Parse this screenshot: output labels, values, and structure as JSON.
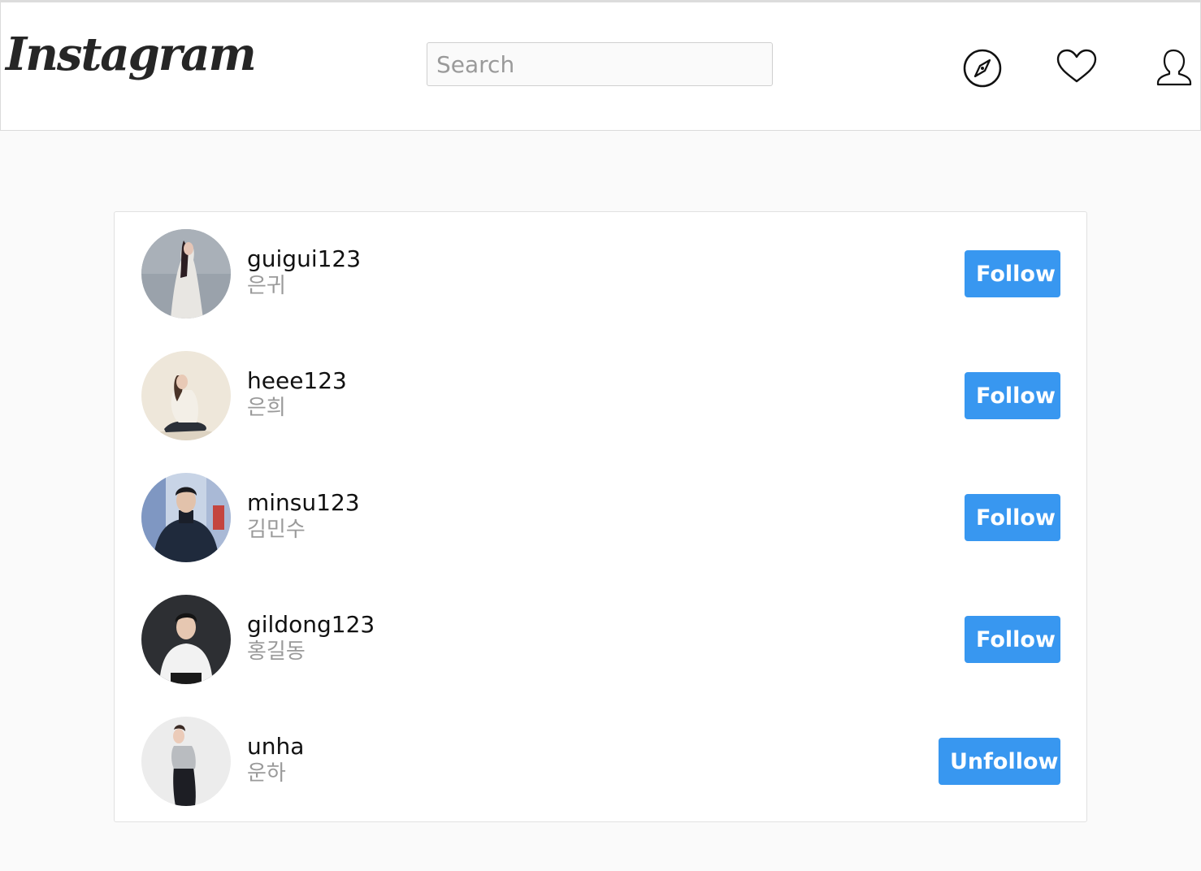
{
  "header": {
    "logo_text": "Instagram",
    "search_placeholder": "Search",
    "icons": [
      "compass-icon",
      "heart-icon",
      "profile-icon"
    ]
  },
  "colors": {
    "accent": "#3897f0",
    "background": "#fafafa",
    "secondary_text": "#999999"
  },
  "users": [
    {
      "username": "guigui123",
      "name": "은귀",
      "button": "Follow"
    },
    {
      "username": "heee123",
      "name": "은희",
      "button": "Follow"
    },
    {
      "username": "minsu123",
      "name": "김민수",
      "button": "Follow"
    },
    {
      "username": "gildong123",
      "name": "홍길동",
      "button": "Follow"
    },
    {
      "username": "unha",
      "name": "운하",
      "button": "Unfollow"
    }
  ]
}
